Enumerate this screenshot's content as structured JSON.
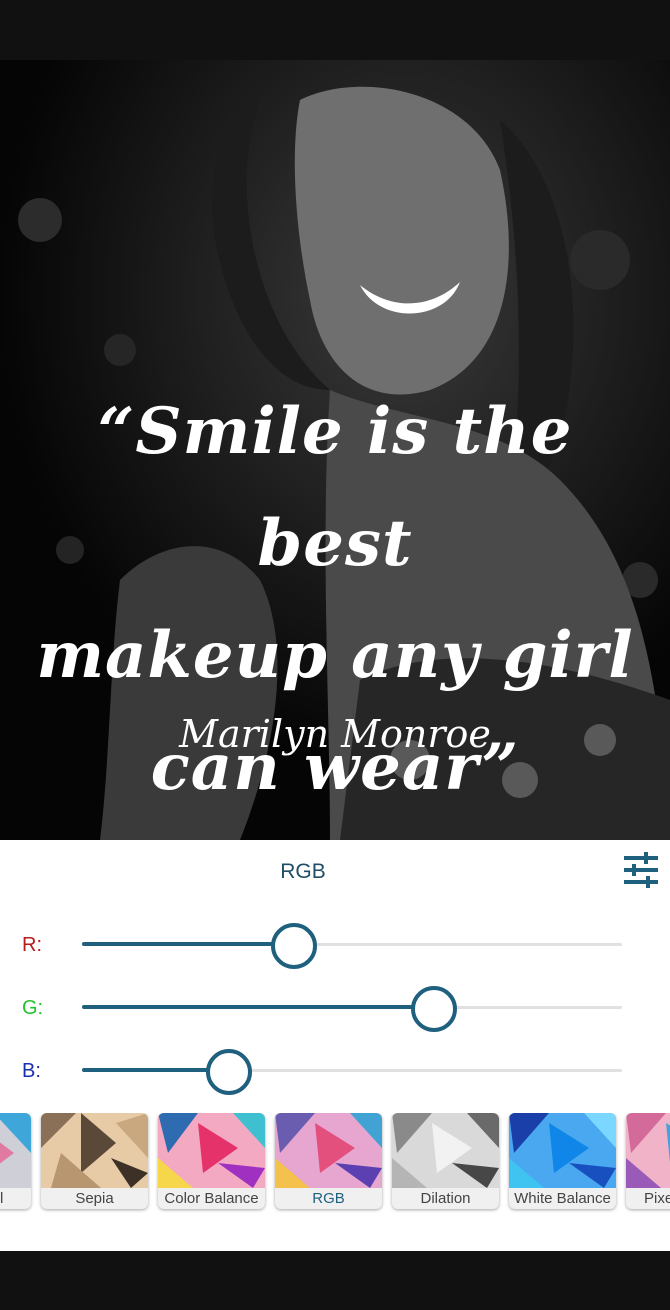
{
  "photo": {
    "quote_lines": [
      "“Smile is the best",
      "makeup any girl",
      "can wear”"
    ],
    "author": "Marilyn Monroe"
  },
  "panel": {
    "title": "RGB",
    "settings_icon": "sliders-icon",
    "sliders": [
      {
        "label": "R:",
        "value": 0.39,
        "color": "#b71c1c"
      },
      {
        "label": "G:",
        "value": 0.65,
        "color": "#22c32c"
      },
      {
        "label": "B:",
        "value": 0.27,
        "color": "#1a2fb4"
      }
    ],
    "accent_color": "#20607f"
  },
  "filters": [
    {
      "label": "Original"
    },
    {
      "label": "Sepia"
    },
    {
      "label": "Color Balance"
    },
    {
      "label": "RGB",
      "active": true
    },
    {
      "label": "Dilation"
    },
    {
      "label": "White Balance"
    },
    {
      "label": "Pixelate"
    }
  ]
}
